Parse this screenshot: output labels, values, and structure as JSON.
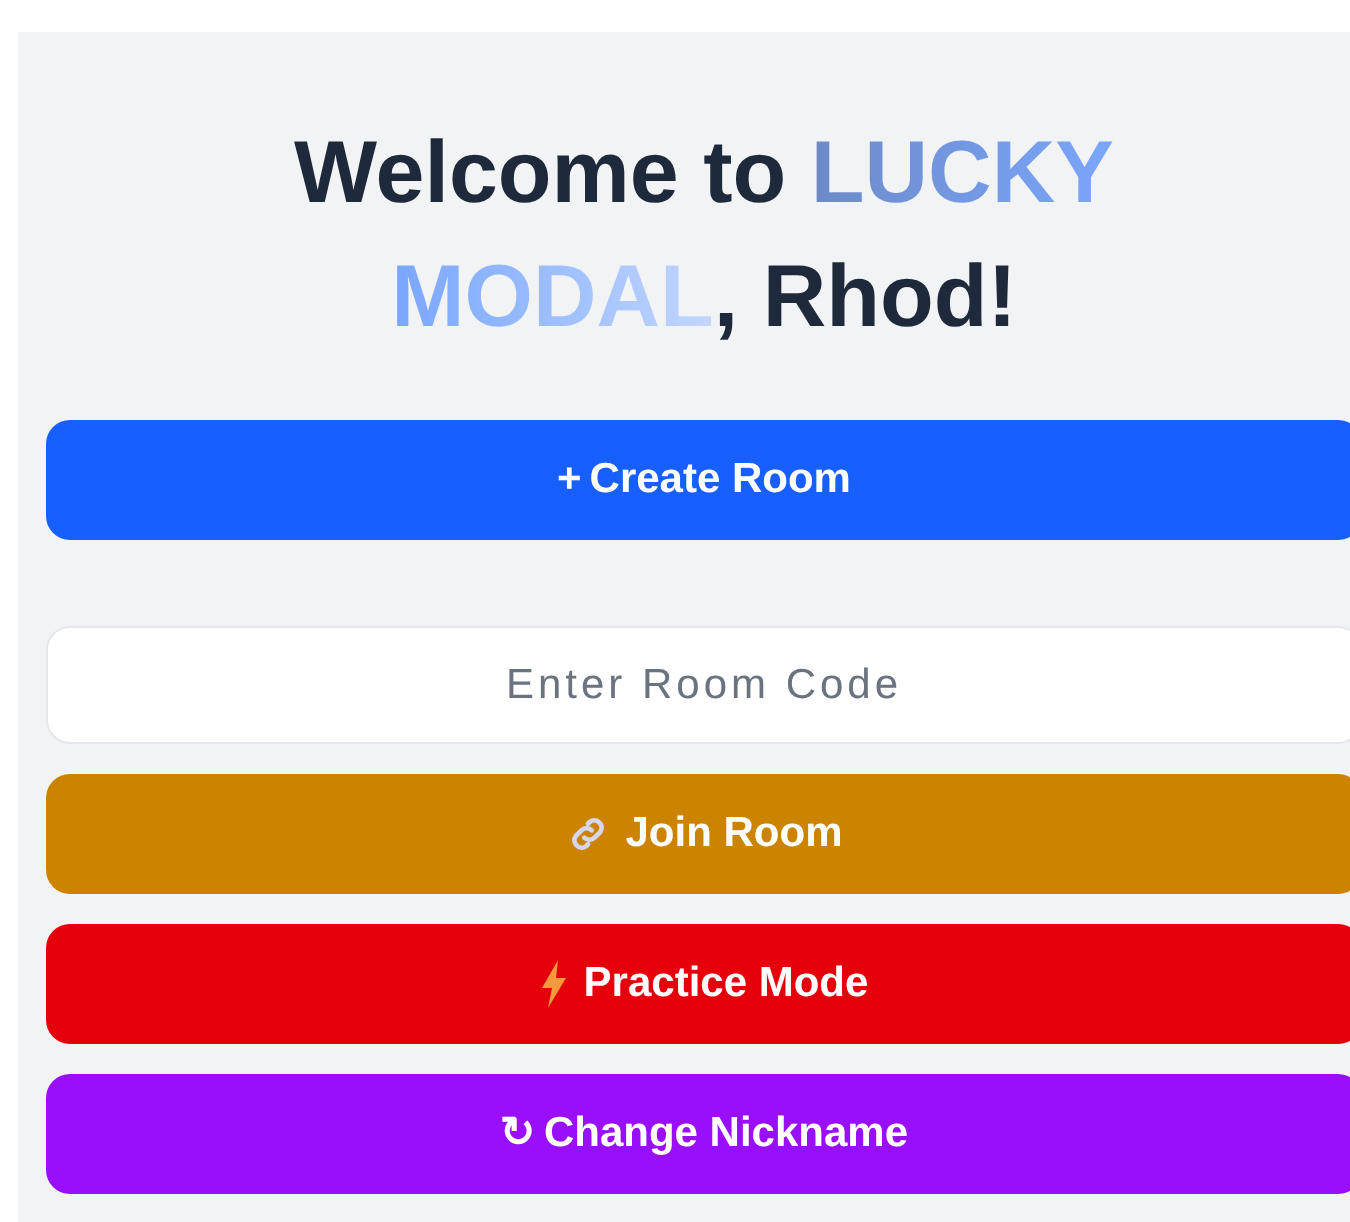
{
  "heading": {
    "prefix": "Welcome to ",
    "highlight": "LUCKY MODAL",
    "suffix": ", Rhod!"
  },
  "room_code": {
    "placeholder": "Enter Room Code"
  },
  "buttons": [
    {
      "kind": "glyph",
      "glyph": "+",
      "label": "Create Room",
      "color": "#1760ff"
    },
    {
      "kind": "link",
      "label": "Join Room",
      "color": "#cc8400"
    },
    {
      "kind": "bolt",
      "label": "Practice Mode",
      "color": "#e5000b"
    },
    {
      "kind": "glyph",
      "glyph": "↻",
      "label": "Change Nickname",
      "color": "#9a0ffb"
    }
  ]
}
